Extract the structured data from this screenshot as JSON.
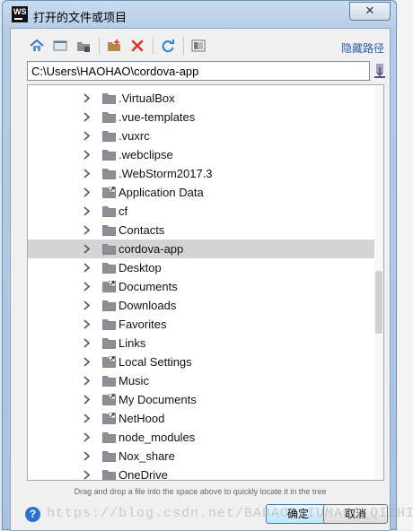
{
  "window": {
    "title": "打开的文件或项目"
  },
  "toolbar": {
    "hide_path_label": "隐藏路径"
  },
  "path": {
    "value": "C:\\Users\\HAOHAO\\cordova-app"
  },
  "tree": {
    "items": [
      {
        "label": ".VirtualBox",
        "shortcut": false,
        "selected": false
      },
      {
        "label": ".vue-templates",
        "shortcut": false,
        "selected": false
      },
      {
        "label": ".vuxrc",
        "shortcut": false,
        "selected": false
      },
      {
        "label": ".webclipse",
        "shortcut": false,
        "selected": false
      },
      {
        "label": ".WebStorm2017.3",
        "shortcut": false,
        "selected": false
      },
      {
        "label": "Application Data",
        "shortcut": true,
        "selected": false
      },
      {
        "label": "cf",
        "shortcut": false,
        "selected": false
      },
      {
        "label": "Contacts",
        "shortcut": false,
        "selected": false
      },
      {
        "label": "cordova-app",
        "shortcut": false,
        "selected": true
      },
      {
        "label": "Desktop",
        "shortcut": false,
        "selected": false
      },
      {
        "label": "Documents",
        "shortcut": true,
        "selected": false
      },
      {
        "label": "Downloads",
        "shortcut": false,
        "selected": false
      },
      {
        "label": "Favorites",
        "shortcut": false,
        "selected": false
      },
      {
        "label": "Links",
        "shortcut": false,
        "selected": false
      },
      {
        "label": "Local Settings",
        "shortcut": true,
        "selected": false
      },
      {
        "label": "Music",
        "shortcut": false,
        "selected": false
      },
      {
        "label": "My Documents",
        "shortcut": true,
        "selected": false
      },
      {
        "label": "NetHood",
        "shortcut": true,
        "selected": false
      },
      {
        "label": "node_modules",
        "shortcut": false,
        "selected": false
      },
      {
        "label": "Nox_share",
        "shortcut": false,
        "selected": false
      },
      {
        "label": "OneDrive",
        "shortcut": false,
        "selected": false
      }
    ]
  },
  "hint": "Drag and drop a file into the space above to quickly locate it in the tree",
  "buttons": {
    "ok": "确定",
    "cancel": "取消"
  },
  "watermark": "https://blog.csdn.net/BADAO_LIUMANG_QIZHI",
  "icons": [
    "home-icon",
    "desktop-icon",
    "project-icon",
    "new-folder-icon",
    "delete-icon",
    "refresh-icon",
    "show-hidden-icon",
    "path-action-icon",
    "help-icon",
    "folder-icon",
    "chevron-right-icon"
  ],
  "colors": {
    "accent_link": "#2a5db0",
    "selected_row": "#d4d4d4",
    "delete_red": "#d9342b",
    "refresh_blue": "#3a86d4"
  }
}
